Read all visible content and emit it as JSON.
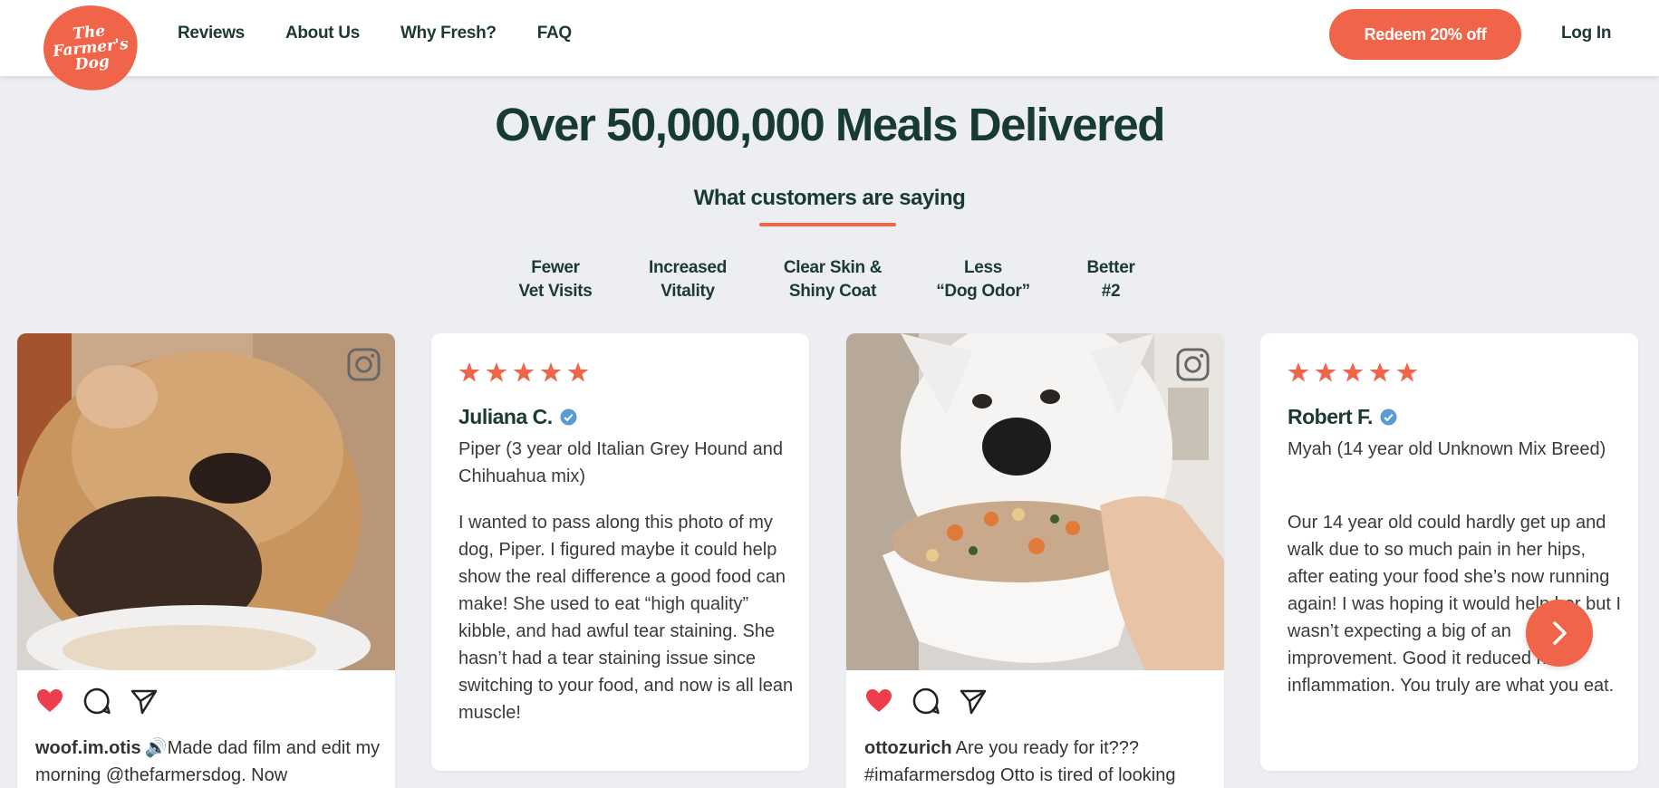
{
  "header": {
    "logo_text": "The\nFarmer's\nDog",
    "nav": [
      "Reviews",
      "About Us",
      "Why Fresh?",
      "FAQ"
    ],
    "redeem_label": "Redeem 20% off",
    "login_label": "Log In"
  },
  "hero": {
    "headline": "Over 50,000,000 Meals Delivered",
    "subhead": "What customers are saying"
  },
  "benefit_tabs": [
    "Fewer\nVet Visits",
    "Increased\nVitality",
    "Clear Skin &\nShiny Coat",
    "Less\n“Dog Odor”",
    "Better\n#2"
  ],
  "cards": [
    {
      "type": "instagram",
      "username": "woof.im.otis",
      "caption": "🔊Made dad film and edit my morning @thefarmersdog. Now"
    },
    {
      "type": "review",
      "stars": 5,
      "reviewer": "Juliana C.",
      "pet": "Piper (3 year old Italian Grey Hound and Chihuahua mix)",
      "text": "I wanted to pass along this photo of my dog, Piper. I figured maybe it could help show the real difference a good food can make! She used to eat “high quality” kibble, and had awful tear staining. She hasn’t had a tear staining issue since switching to your food, and now is all lean muscle!"
    },
    {
      "type": "instagram",
      "username": "ottozurich",
      "caption": "Are you ready for it??? #imafarmersdog Otto is tired of looking"
    },
    {
      "type": "review",
      "stars": 5,
      "reviewer": "Robert F.",
      "pet": "Myah (14 year old Unknown Mix Breed)",
      "text": "Our 14 year old could hardly get up and walk due to so much pain in her hips, after eating your food she’s now running again! I was hoping it would help her but I wasn’t expecting a big of an improvement. Good it reduced her inflammation. You truly are what you eat."
    }
  ],
  "colors": {
    "brand_orange": "#f0644a",
    "heading_green": "#173b31",
    "page_bg": "#eceef2",
    "heart_red": "#ed3e50",
    "verified_blue": "#5b9bd5"
  },
  "icons": [
    "instagram-icon",
    "heart-icon",
    "comment-icon",
    "share-icon",
    "star-icon",
    "verified-badge-icon",
    "chevron-right-icon"
  ]
}
